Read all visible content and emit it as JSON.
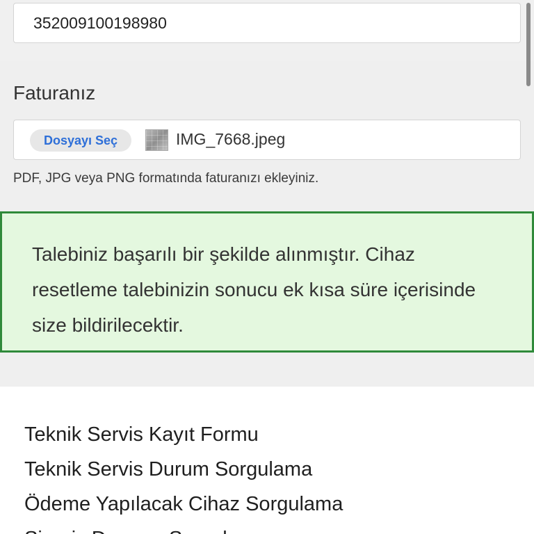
{
  "imei_field": {
    "value": "352009100198980"
  },
  "invoice": {
    "label": "Faturanız",
    "choose_button_label": "Dosyayı Seç",
    "thumbnail_icon": "image-thumbnail-icon",
    "file_name": "IMG_7668.jpeg",
    "help_text": "PDF, JPG veya PNG formatında faturanızı ekleyiniz."
  },
  "success_message": {
    "text": "Talebiniz başarılı bir şekilde alınmıştır. Cihaz resetleme talebinizin sonucu ek kısa süre içerisinde size bildirilecektir.",
    "background_color": "#e4f8df",
    "border_color": "#2f8a3a"
  },
  "footer_links": [
    {
      "label": "Teknik Servis Kayıt Formu"
    },
    {
      "label": "Teknik Servis Durum Sorgulama"
    },
    {
      "label": "Ödeme Yapılacak Cihaz Sorgulama"
    },
    {
      "label": "Sipariş Durumu Sorgulama"
    }
  ],
  "colors": {
    "accent": "#2e6fd8",
    "page_background": "#efefef"
  }
}
